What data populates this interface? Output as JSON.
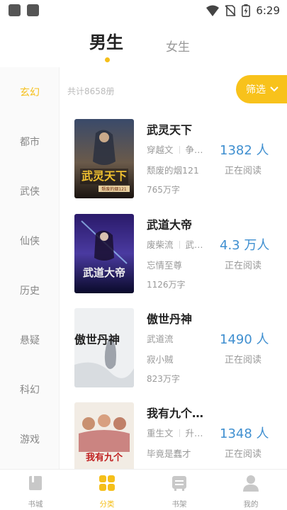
{
  "status_bar": {
    "time": "6:29"
  },
  "gender_tabs": {
    "male": "男生",
    "female": "女生"
  },
  "categories": [
    "玄幻",
    "都市",
    "武侠",
    "仙侠",
    "历史",
    "悬疑",
    "科幻",
    "游戏"
  ],
  "active_category": "玄幻",
  "total_text": "共计8658册",
  "filter_label": "筛选",
  "books": [
    {
      "title": "武灵天下",
      "tags": [
        "穿越文",
        "争…"
      ],
      "author": "颓废的烟121",
      "words": "765万字",
      "count": "1382 人",
      "reading": "正在阅读",
      "cover_text": "武灵天下",
      "cover_sub": "颓废的烟121"
    },
    {
      "title": "武道大帝",
      "tags": [
        "废柴流",
        "武…"
      ],
      "author": "忘情至尊",
      "words": "1126万字",
      "count": "4.3 万人",
      "reading": "正在阅读",
      "cover_text": "武道大帝",
      "cover_sub": ""
    },
    {
      "title": "傲世丹神",
      "tags": [
        "武道流"
      ],
      "author": "寂小贼",
      "words": "823万字",
      "count": "1490 人",
      "reading": "正在阅读",
      "cover_text": "傲世丹神",
      "cover_sub": ""
    },
    {
      "title": "我有九个…",
      "tags": [
        "重生文",
        "升…"
      ],
      "author": "毕竟是蠢才",
      "words": "",
      "count": "1348 人",
      "reading": "正在阅读",
      "cover_text": "我有九个",
      "cover_sub": ""
    }
  ],
  "bottom_nav": [
    {
      "label": "书城",
      "icon": "book-icon"
    },
    {
      "label": "分类",
      "icon": "grid-icon"
    },
    {
      "label": "书架",
      "icon": "shelf-icon"
    },
    {
      "label": "我的",
      "icon": "person-icon"
    }
  ],
  "colors": {
    "accent": "#f5bf1a",
    "count_blue": "#3f8fd0"
  }
}
